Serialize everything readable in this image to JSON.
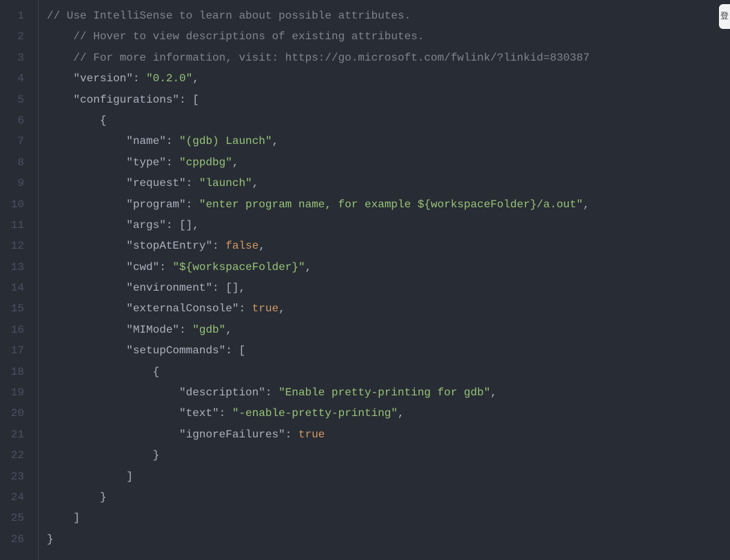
{
  "lines": [
    {
      "n": 1,
      "indent": 0,
      "tokens": [
        {
          "t": "// Use IntelliSense to learn about possible attributes.",
          "c": "comment"
        }
      ]
    },
    {
      "n": 2,
      "indent": 4,
      "tokens": [
        {
          "t": "// Hover to view descriptions of existing attributes.",
          "c": "comment"
        }
      ]
    },
    {
      "n": 3,
      "indent": 4,
      "tokens": [
        {
          "t": "// For more information, visit: https://go.microsoft.com/fwlink/?linkid=830387",
          "c": "comment"
        }
      ]
    },
    {
      "n": 4,
      "indent": 4,
      "tokens": [
        {
          "t": "\"version\"",
          "c": "key"
        },
        {
          "t": ": ",
          "c": "punc"
        },
        {
          "t": "\"0.2.0\"",
          "c": "string"
        },
        {
          "t": ",",
          "c": "punc"
        }
      ]
    },
    {
      "n": 5,
      "indent": 4,
      "tokens": [
        {
          "t": "\"configurations\"",
          "c": "key"
        },
        {
          "t": ": [",
          "c": "punc"
        }
      ]
    },
    {
      "n": 6,
      "indent": 8,
      "tokens": [
        {
          "t": "{",
          "c": "punc"
        }
      ]
    },
    {
      "n": 7,
      "indent": 12,
      "tokens": [
        {
          "t": "\"name\"",
          "c": "key"
        },
        {
          "t": ": ",
          "c": "punc"
        },
        {
          "t": "\"(gdb) Launch\"",
          "c": "string"
        },
        {
          "t": ",",
          "c": "punc"
        }
      ]
    },
    {
      "n": 8,
      "indent": 12,
      "tokens": [
        {
          "t": "\"type\"",
          "c": "key"
        },
        {
          "t": ": ",
          "c": "punc"
        },
        {
          "t": "\"cppdbg\"",
          "c": "string"
        },
        {
          "t": ",",
          "c": "punc"
        }
      ]
    },
    {
      "n": 9,
      "indent": 12,
      "tokens": [
        {
          "t": "\"request\"",
          "c": "key"
        },
        {
          "t": ": ",
          "c": "punc"
        },
        {
          "t": "\"launch\"",
          "c": "string"
        },
        {
          "t": ",",
          "c": "punc"
        }
      ]
    },
    {
      "n": 10,
      "indent": 12,
      "tokens": [
        {
          "t": "\"program\"",
          "c": "key"
        },
        {
          "t": ": ",
          "c": "punc"
        },
        {
          "t": "\"enter program name, for example ${workspaceFolder}/a.out\"",
          "c": "string"
        },
        {
          "t": ",",
          "c": "punc"
        }
      ]
    },
    {
      "n": 11,
      "indent": 12,
      "tokens": [
        {
          "t": "\"args\"",
          "c": "key"
        },
        {
          "t": ": [],",
          "c": "punc"
        }
      ]
    },
    {
      "n": 12,
      "indent": 12,
      "tokens": [
        {
          "t": "\"stopAtEntry\"",
          "c": "key"
        },
        {
          "t": ": ",
          "c": "punc"
        },
        {
          "t": "false",
          "c": "bool"
        },
        {
          "t": ",",
          "c": "punc"
        }
      ]
    },
    {
      "n": 13,
      "indent": 12,
      "tokens": [
        {
          "t": "\"cwd\"",
          "c": "key"
        },
        {
          "t": ": ",
          "c": "punc"
        },
        {
          "t": "\"${workspaceFolder}\"",
          "c": "string"
        },
        {
          "t": ",",
          "c": "punc"
        }
      ]
    },
    {
      "n": 14,
      "indent": 12,
      "tokens": [
        {
          "t": "\"environment\"",
          "c": "key"
        },
        {
          "t": ": [],",
          "c": "punc"
        }
      ]
    },
    {
      "n": 15,
      "indent": 12,
      "tokens": [
        {
          "t": "\"externalConsole\"",
          "c": "key"
        },
        {
          "t": ": ",
          "c": "punc"
        },
        {
          "t": "true",
          "c": "bool"
        },
        {
          "t": ",",
          "c": "punc"
        }
      ]
    },
    {
      "n": 16,
      "indent": 12,
      "tokens": [
        {
          "t": "\"MIMode\"",
          "c": "key"
        },
        {
          "t": ": ",
          "c": "punc"
        },
        {
          "t": "\"gdb\"",
          "c": "string"
        },
        {
          "t": ",",
          "c": "punc"
        }
      ]
    },
    {
      "n": 17,
      "indent": 12,
      "tokens": [
        {
          "t": "\"setupCommands\"",
          "c": "key"
        },
        {
          "t": ": [",
          "c": "punc"
        }
      ]
    },
    {
      "n": 18,
      "indent": 16,
      "tokens": [
        {
          "t": "{",
          "c": "punc"
        }
      ]
    },
    {
      "n": 19,
      "indent": 20,
      "tokens": [
        {
          "t": "\"description\"",
          "c": "key"
        },
        {
          "t": ": ",
          "c": "punc"
        },
        {
          "t": "\"Enable pretty-printing for gdb\"",
          "c": "string"
        },
        {
          "t": ",",
          "c": "punc"
        }
      ]
    },
    {
      "n": 20,
      "indent": 20,
      "tokens": [
        {
          "t": "\"text\"",
          "c": "key"
        },
        {
          "t": ": ",
          "c": "punc"
        },
        {
          "t": "\"-enable-pretty-printing\"",
          "c": "string"
        },
        {
          "t": ",",
          "c": "punc"
        }
      ]
    },
    {
      "n": 21,
      "indent": 20,
      "tokens": [
        {
          "t": "\"ignoreFailures\"",
          "c": "key"
        },
        {
          "t": ": ",
          "c": "punc"
        },
        {
          "t": "true",
          "c": "bool"
        }
      ]
    },
    {
      "n": 22,
      "indent": 16,
      "tokens": [
        {
          "t": "}",
          "c": "punc"
        }
      ]
    },
    {
      "n": 23,
      "indent": 12,
      "tokens": [
        {
          "t": "]",
          "c": "punc"
        }
      ]
    },
    {
      "n": 24,
      "indent": 8,
      "tokens": [
        {
          "t": "}",
          "c": "punc"
        }
      ]
    },
    {
      "n": 25,
      "indent": 4,
      "tokens": [
        {
          "t": "]",
          "c": "punc"
        }
      ]
    },
    {
      "n": 26,
      "indent": 0,
      "tokens": [
        {
          "t": "}",
          "c": "punc"
        }
      ]
    }
  ],
  "corner_label": "登"
}
